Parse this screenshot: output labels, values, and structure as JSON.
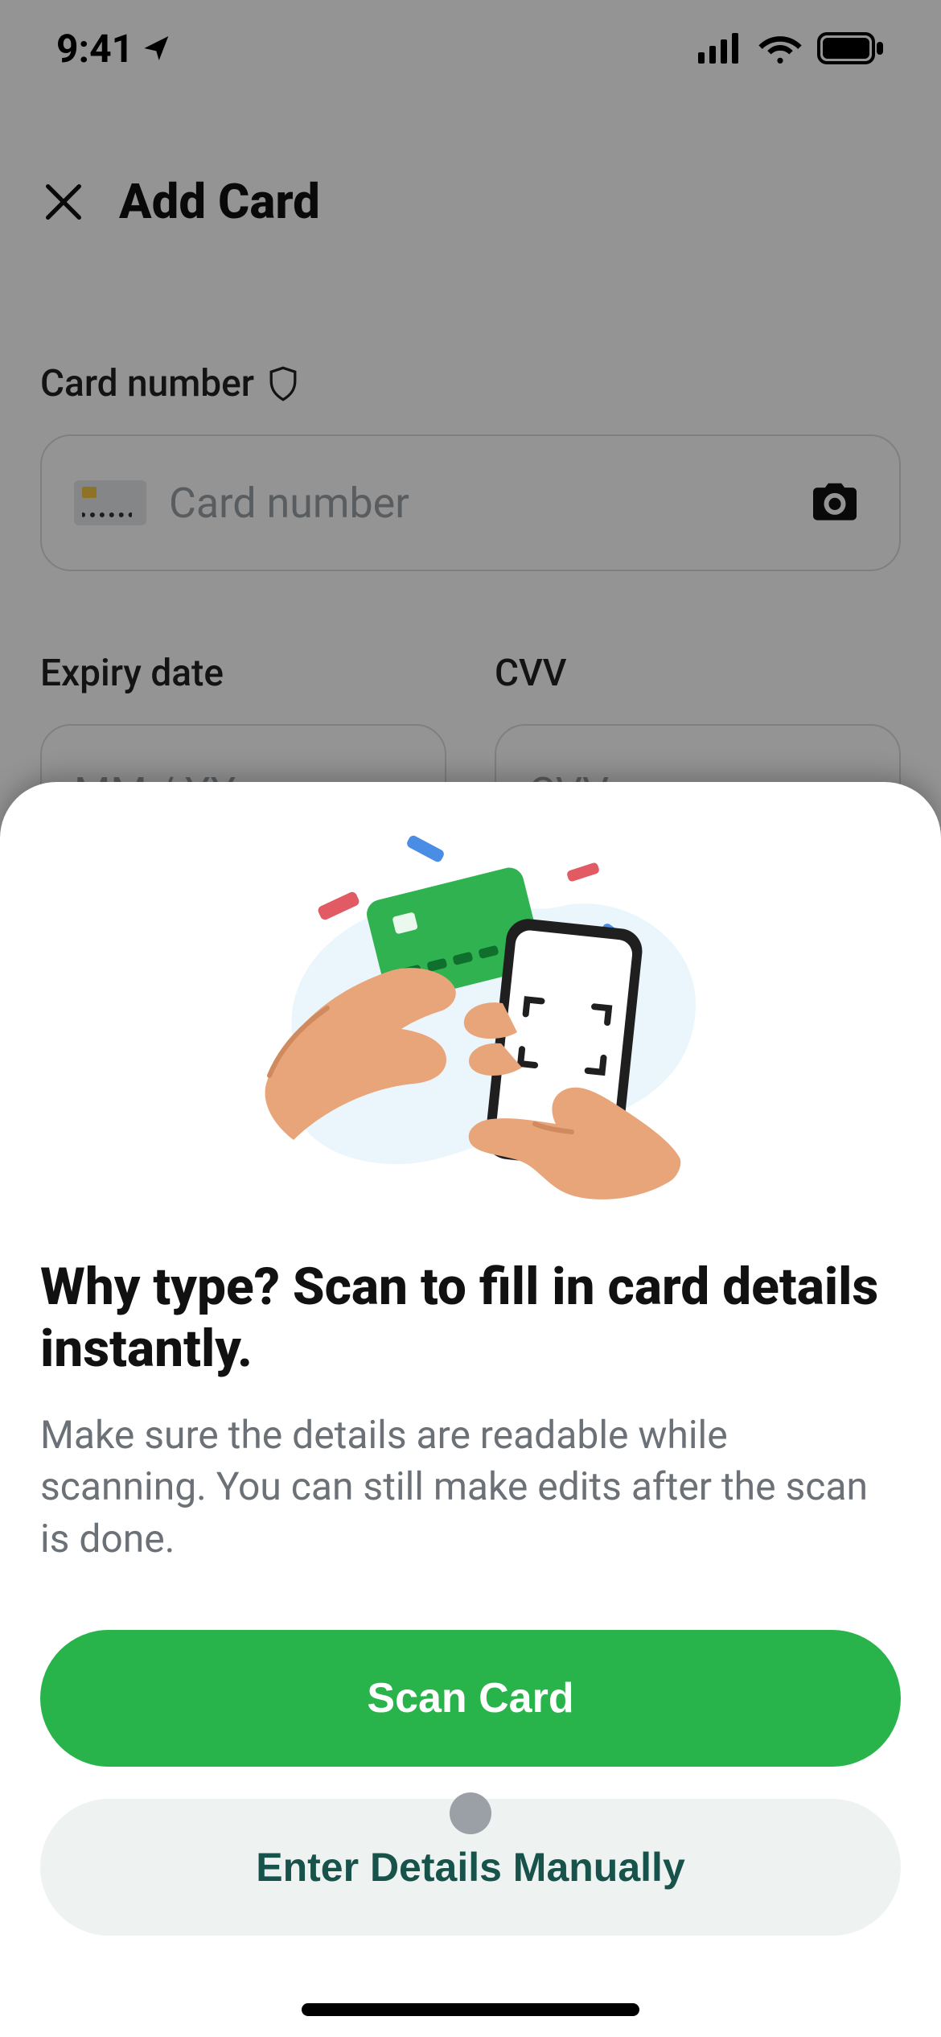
{
  "status": {
    "time": "9:41"
  },
  "header": {
    "title": "Add Card"
  },
  "form": {
    "card_number_label": "Card number",
    "card_number_placeholder": "Card number",
    "expiry_label": "Expiry date",
    "expiry_placeholder": "MM / YY",
    "cvv_label": "CVV",
    "cvv_placeholder": "CVV"
  },
  "sheet": {
    "title": "Why type? Scan to fill in card details instantly.",
    "description": "Make sure the details are readable while scanning. You can still make edits after the scan is done.",
    "primary": "Scan Card",
    "secondary": "Enter Details Manually"
  },
  "colors": {
    "accent": "#28b44b"
  }
}
